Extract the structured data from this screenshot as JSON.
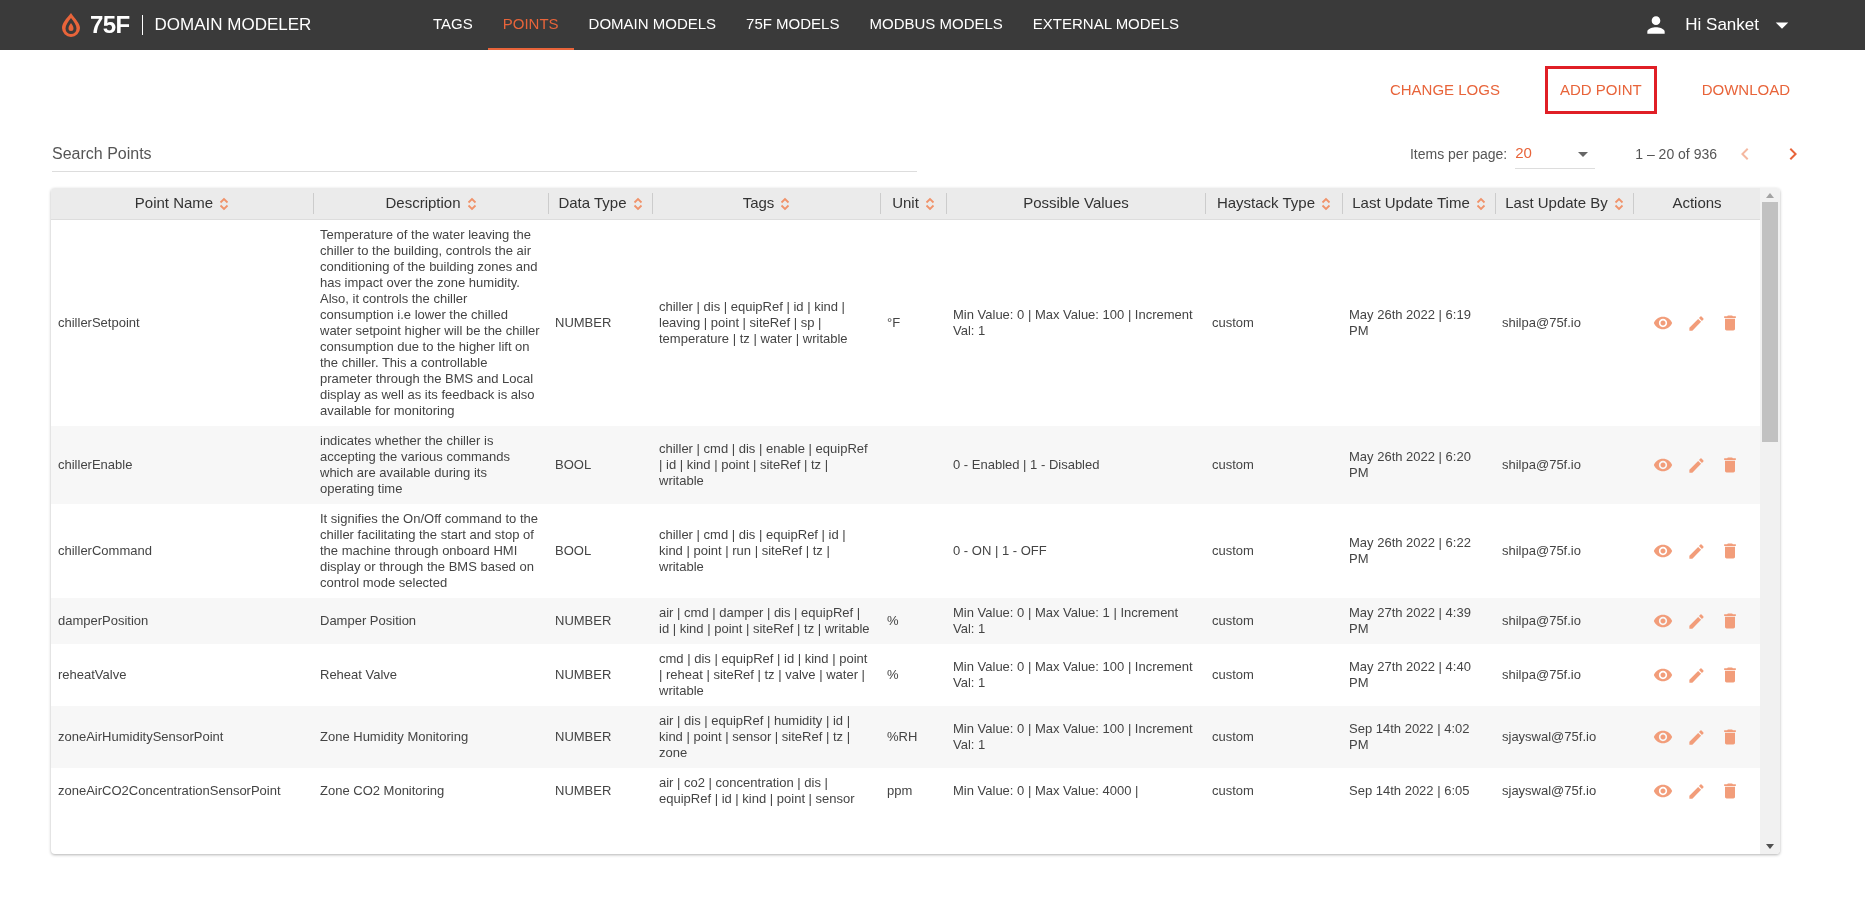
{
  "header": {
    "logo_text": "75F",
    "app_name": "DOMAIN MODELER",
    "nav": [
      {
        "label": "TAGS",
        "selected": false
      },
      {
        "label": "POINTS",
        "selected": true
      },
      {
        "label": "DOMAIN MODELS",
        "selected": false
      },
      {
        "label": "75F MODELS",
        "selected": false
      },
      {
        "label": "MODBUS MODELS",
        "selected": false
      },
      {
        "label": "EXTERNAL MODELS",
        "selected": false
      }
    ],
    "user": {
      "greeting": "Hi Sanket"
    }
  },
  "actions": [
    {
      "label": "CHANGE LOGS",
      "outlined": false
    },
    {
      "label": "ADD POINT",
      "outlined": true
    },
    {
      "label": "DOWNLOAD",
      "outlined": false
    }
  ],
  "search": {
    "placeholder": "Search Points"
  },
  "pagination": {
    "items_per_page_label": "Items per page:",
    "items_per_page": "20",
    "range": "1 – 20 of 936",
    "prev_disabled": true,
    "next_disabled": false
  },
  "table": {
    "columns": [
      {
        "label": "Point Name",
        "sortable": true
      },
      {
        "label": "Description",
        "sortable": true
      },
      {
        "label": "Data Type",
        "sortable": true
      },
      {
        "label": "Tags",
        "sortable": true
      },
      {
        "label": "Unit",
        "sortable": true
      },
      {
        "label": "Possible Values",
        "sortable": false
      },
      {
        "label": "Haystack Type",
        "sortable": true
      },
      {
        "label": "Last Update Time",
        "sortable": true
      },
      {
        "label": "Last Update By",
        "sortable": true
      },
      {
        "label": "Actions",
        "sortable": false
      }
    ],
    "rows": [
      {
        "point_name": "chillerSetpoint",
        "description": "Temperature of the water leaving the chiller to the building, controls the air conditioning of the building zones and has impact over the zone humidity. Also, it controls the chiller consumption i.e lower the chilled water setpoint higher will be the chiller consumption due to the higher lift on the chiller. This a controllable prameter through the BMS and Local display as well as its feedback is also available for monitoring",
        "data_type": "NUMBER",
        "tags": "chiller | dis | equipRef | id | kind | leaving | point | siteRef | sp | temperature | tz | water | writable",
        "unit": "°F",
        "possible_values": "Min Value: 0 | Max Value: 100 | Increment Val: 1",
        "haystack_type": "custom",
        "last_update_time": "May 26th 2022 | 6:19 PM",
        "last_update_by": "shilpa@75f.io"
      },
      {
        "point_name": "chillerEnable",
        "description": "indicates whether the chiller is accepting the various commands which are available during its operating time",
        "data_type": "BOOL",
        "tags": "chiller | cmd | dis | enable | equipRef | id | kind | point | siteRef | tz | writable",
        "unit": "",
        "possible_values": "0 - Enabled | 1 - Disabled",
        "haystack_type": "custom",
        "last_update_time": "May 26th 2022 | 6:20 PM",
        "last_update_by": "shilpa@75f.io"
      },
      {
        "point_name": "chillerCommand",
        "description": "It signifies the On/Off command to the chiller facilitating the start and stop of the machine through onboard HMI display or through the BMS based on control mode selected",
        "data_type": "BOOL",
        "tags": "chiller | cmd | dis | equipRef | id | kind | point | run | siteRef | tz | writable",
        "unit": "",
        "possible_values": "0 - ON | 1 - OFF",
        "haystack_type": "custom",
        "last_update_time": "May 26th 2022 | 6:22 PM",
        "last_update_by": "shilpa@75f.io"
      },
      {
        "point_name": "damperPosition",
        "description": "Damper Position",
        "data_type": "NUMBER",
        "tags": "air | cmd | damper | dis | equipRef | id | kind | point | siteRef | tz | writable",
        "unit": "%",
        "possible_values": "Min Value: 0 | Max Value: 1 | Increment Val: 1",
        "haystack_type": "custom",
        "last_update_time": "May 27th 2022 | 4:39 PM",
        "last_update_by": "shilpa@75f.io"
      },
      {
        "point_name": "reheatValve",
        "description": "Reheat Valve",
        "data_type": "NUMBER",
        "tags": "cmd | dis | equipRef | id | kind | point | reheat | siteRef | tz | valve | water | writable",
        "unit": "%",
        "possible_values": "Min Value: 0 | Max Value: 100 | Increment Val: 1",
        "haystack_type": "custom",
        "last_update_time": "May 27th 2022 | 4:40 PM",
        "last_update_by": "shilpa@75f.io"
      },
      {
        "point_name": "zoneAirHumiditySensorPoint",
        "description": "Zone Humidity Monitoring",
        "data_type": "NUMBER",
        "tags": "air | dis | equipRef | humidity | id | kind | point | sensor | siteRef | tz | zone",
        "unit": "%RH",
        "possible_values": "Min Value: 0 | Max Value: 100 | Increment Val: 1",
        "haystack_type": "custom",
        "last_update_time": "Sep 14th 2022 | 4:02 PM",
        "last_update_by": "sjayswal@75f.io"
      },
      {
        "point_name": "zoneAirCO2ConcentrationSensorPoint",
        "description": "Zone CO2 Monitoring",
        "data_type": "NUMBER",
        "tags": "air | co2 | concentration | dis | equipRef | id | kind | point | sensor",
        "unit": "ppm",
        "possible_values": "Min Value: 0 | Max Value: 4000 |",
        "haystack_type": "custom",
        "last_update_time": "Sep 14th 2022 | 6:05",
        "last_update_by": "sjayswal@75f.io"
      }
    ]
  }
}
